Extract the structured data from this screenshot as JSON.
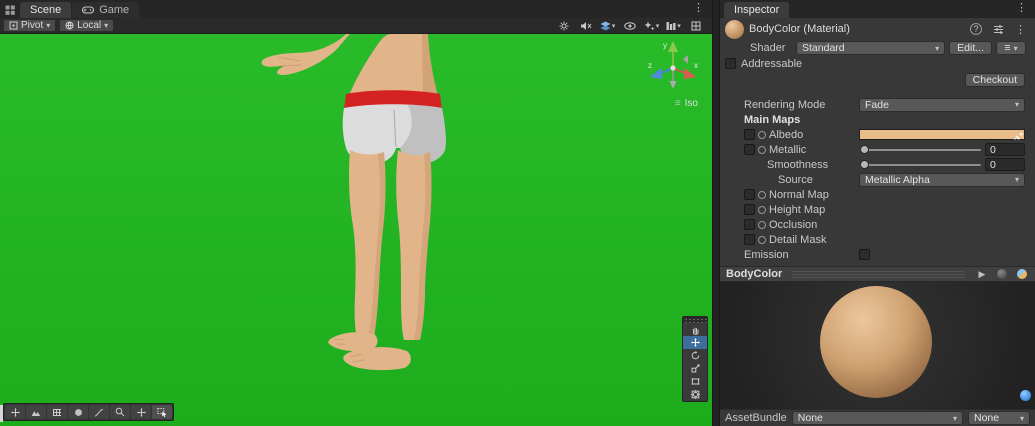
{
  "icons": {
    "caret": "▾",
    "kebab": "⋮",
    "help": "?",
    "hamburger": "≡",
    "play": "▶"
  },
  "colors": {
    "scene_green": "#1eb71e",
    "albedo_swatch": "#e8bd8a",
    "skin": "#e2b489",
    "skin_shadow": "#bc8d60",
    "shorts": "#dcdcdc",
    "shorts_shadow": "#b9b9b9",
    "waistband_red": "#d42222",
    "accent_blue": "#3d6e9e",
    "sphere_light": "#ecc89e",
    "sphere_dark": "#7a5638"
  },
  "scene_panel": {
    "tabs": [
      {
        "label": "Scene"
      },
      {
        "label": "Game"
      }
    ],
    "toolbar": {
      "pivot": "Pivot",
      "local": "Local"
    },
    "gizmo": {
      "x": "x",
      "y": "y",
      "z": "z",
      "mode": "Iso"
    }
  },
  "inspector": {
    "tab": "Inspector",
    "title": "BodyColor (Material)",
    "shader": {
      "label": "Shader",
      "value": "Standard",
      "edit_button": "Edit..."
    },
    "addressable_label": "Addressable",
    "checkout_button": "Checkout",
    "rendering_mode": {
      "label": "Rendering Mode",
      "value": "Fade"
    },
    "main_maps": {
      "title": "Main Maps",
      "albedo_label": "Albedo",
      "metallic_label": "Metallic",
      "metallic_value": "0",
      "smoothness_label": "Smoothness",
      "smoothness_value": "0",
      "source_label": "Source",
      "source_value": "Metallic Alpha",
      "normal_map_label": "Normal Map",
      "height_map_label": "Height Map",
      "occlusion_label": "Occlusion",
      "detail_mask_label": "Detail Mask",
      "emission_label": "Emission"
    },
    "preview_title": "BodyColor",
    "asset_bundle": {
      "label": "AssetBundle",
      "bundle": "None",
      "variant": "None"
    }
  }
}
